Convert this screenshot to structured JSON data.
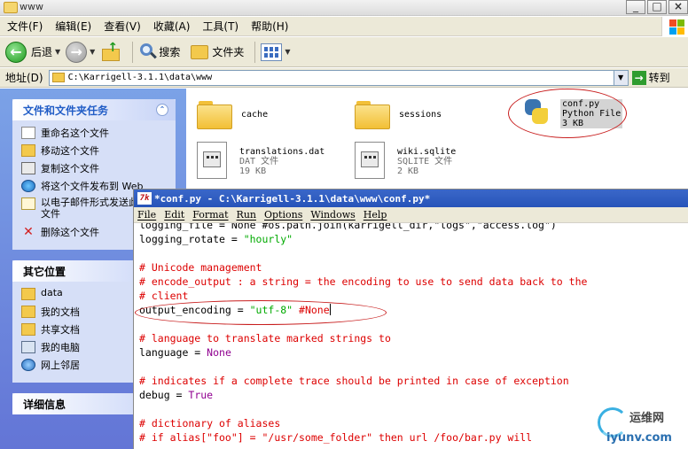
{
  "explorer": {
    "title": "www",
    "menu": [
      "文件(F)",
      "编辑(E)",
      "查看(V)",
      "收藏(A)",
      "工具(T)",
      "帮助(H)"
    ],
    "toolbar": {
      "back_label": "后退",
      "search_label": "搜索",
      "folders_label": "文件夹"
    },
    "address": {
      "label": "地址(D)",
      "value": "C:\\Karrigell-3.1.1\\data\\www",
      "go_label": "转到"
    },
    "tasks": {
      "title": "文件和文件夹任务",
      "items": [
        "重命名这个文件",
        "移动这个文件",
        "复制这个文件",
        "将这个文件发布到 Web",
        "以电子邮件形式发送此文件",
        "删除这个文件"
      ]
    },
    "places": {
      "title": "其它位置",
      "items": [
        "data",
        "我的文档",
        "共享文档",
        "我的电脑",
        "网上邻居"
      ]
    },
    "details": {
      "title": "详细信息"
    },
    "files": [
      {
        "name": "cache",
        "type": "",
        "size": ""
      },
      {
        "name": "sessions",
        "type": "",
        "size": ""
      },
      {
        "name": "conf.py",
        "type": "Python File",
        "size": "3 KB"
      },
      {
        "name": "translations.dat",
        "type": "DAT 文件",
        "size": "19 KB"
      },
      {
        "name": "wiki.sqlite",
        "type": "SQLITE 文件",
        "size": "2 KB"
      }
    ]
  },
  "editor": {
    "title": "*conf.py - C:\\Karrigell-3.1.1\\data\\www\\conf.py*",
    "menu": [
      "File",
      "Edit",
      "Format",
      "Run",
      "Options",
      "Windows",
      "Help"
    ],
    "lines": {
      "l1": "logging_file = None #os.path.join(karrigell_dir,\"logs\",\"access.log\")",
      "l2a": "logging_rotate = ",
      "l2b": "\"hourly\"",
      "l3": "# Unicode management",
      "l4": "# encode_output : a string = the encoding to use to send data back to the",
      "l5": "# client",
      "l6a": "output_encoding = ",
      "l6b": "\"utf-8\"",
      "l6c": " #None",
      "l7": "# language to translate marked strings to",
      "l8a": "language = ",
      "l8b": "None",
      "l9": "# indicates if a complete trace should be printed in case of exception",
      "l10a": "debug = ",
      "l10b": "True",
      "l11": "# dictionary of aliases",
      "l12a": "# if alias[\"foo\"] = \"/usr/some_folder\" then url /foo/bar.py will"
    }
  },
  "watermark": {
    "cn": "运维网",
    "en": "iyunv.com"
  },
  "colors": {
    "title_blue": "#2754b9",
    "taskpane_blue": "#6375d6",
    "annotation_red": "#c81e1e"
  }
}
